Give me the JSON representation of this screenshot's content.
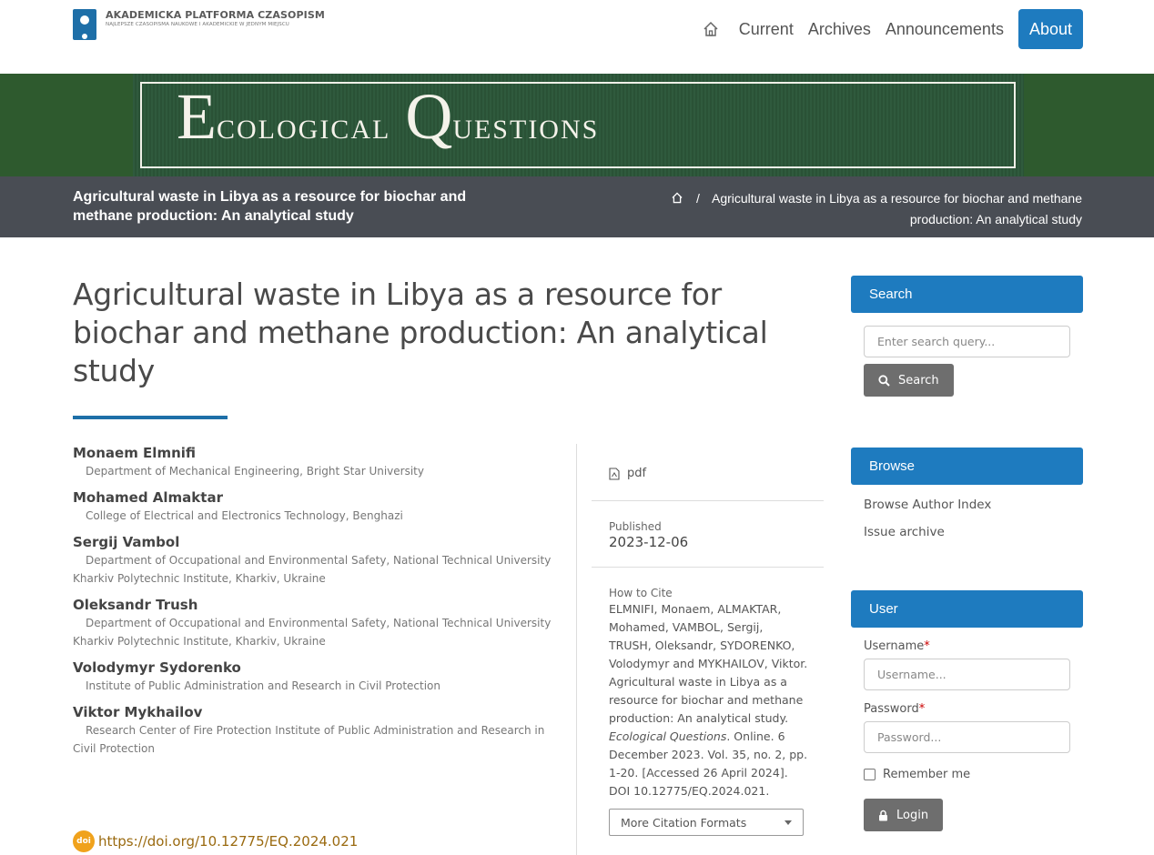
{
  "header": {
    "logo_title": "AKADEMICKA PLATFORMA CZASOPISM",
    "logo_subtitle": "NAJLEPSZE CZASOPISMA NAUKOWE I AKADEMICKIE W JEDNYM MIEJSCU",
    "nav": [
      {
        "label": "Current"
      },
      {
        "label": "Archives"
      },
      {
        "label": "Announcements"
      },
      {
        "label": "About"
      }
    ]
  },
  "banner": {
    "word1_initial": "E",
    "word1_rest": "cological",
    "word2_initial": "Q",
    "word2_rest": "uestions"
  },
  "breadcrumb": {
    "page_title": "Agricultural waste in Libya as a resource for biochar and methane production: An analytical study",
    "separator": "/",
    "current": "Agricultural waste in Libya as a resource for biochar and methane production: An analytical study"
  },
  "article": {
    "title": "Agricultural waste in Libya as a resource for biochar and methane production: An analytical study",
    "authors": [
      {
        "name": "Monaem Elmnifi",
        "affiliation": "Department of Mechanical Engineering, Bright Star University"
      },
      {
        "name": "Mohamed Almaktar",
        "affiliation": "College of Electrical and Electronics Technology, Benghazi"
      },
      {
        "name": "Sergij Vambol",
        "affiliation": "Department of Occupational and Environmental Safety, National Technical University Kharkiv Polytechnic Institute, Kharkiv, Ukraine"
      },
      {
        "name": "Oleksandr Trush",
        "affiliation": "Department of Occupational and Environmental Safety, National Technical University Kharkiv Polytechnic Institute, Kharkiv, Ukraine"
      },
      {
        "name": "Volodymyr Sydorenko",
        "affiliation": "Institute of Public Administration and Research in Civil Protection"
      },
      {
        "name": "Viktor Mykhailov",
        "affiliation": "Research Center of Fire Protection Institute of Public Administration and Research in Civil Protection"
      }
    ],
    "doi_badge": "doi",
    "doi_link": "https://doi.org/10.12775/EQ.2024.021"
  },
  "details": {
    "pdf_label": "pdf",
    "published_label": "Published",
    "published_date": "2023-12-06",
    "cite_label": "How to Cite",
    "cite_part1": "ELMNIFI, Monaem, ALMAKTAR, Mohamed, VAMBOL, Sergij, TRUSH, Oleksandr, SYDORENKO, Volodymyr and MYKHAILOV, Viktor. Agricultural waste in Libya as a resource for biochar and methane production: An analytical study. ",
    "cite_journal": "Ecological Questions",
    "cite_part2": ". Online. 6 December 2023. Vol. 35, no. 2, pp. 1-20. [Accessed 26 April 2024]. DOI 10.12775/EQ.2024.021.",
    "citation_formats": "More Citation Formats"
  },
  "sidebar": {
    "search_heading": "Search",
    "search_placeholder": "Enter search query...",
    "search_button": "Search",
    "browse_heading": "Browse",
    "browse_links": [
      {
        "label": "Browse Author Index"
      },
      {
        "label": "Issue archive"
      }
    ],
    "user_heading": "User",
    "username_label": "Username",
    "username_placeholder": "Username...",
    "password_label": "Password",
    "password_placeholder": "Password...",
    "required_mark": "*",
    "remember_label": "Remember me",
    "login_button": "Login"
  },
  "colors": {
    "accent": "#1e7bbf",
    "breadcrumb_bar": "#494d54",
    "banner_green": "#2e5a2e"
  }
}
